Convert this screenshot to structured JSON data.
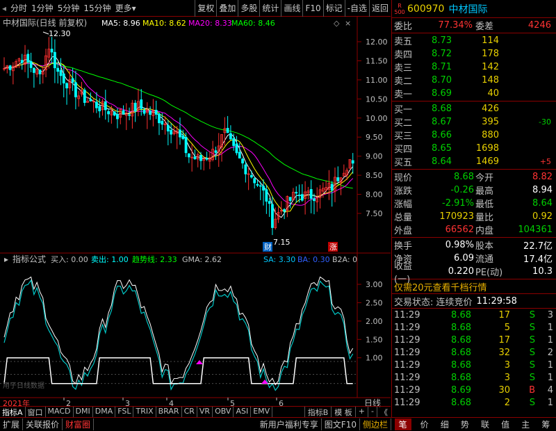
{
  "toolbar": {
    "items": [
      "分时",
      "1分钟",
      "5分钟",
      "15分钟",
      "更多",
      "复权",
      "叠加",
      "多股",
      "统计",
      "画线",
      "F10",
      "标记",
      "-自选",
      "返回"
    ]
  },
  "main_chart": {
    "title": "中材国际(日线 前复权)",
    "ma5_label": "MA5: 8.96",
    "ma10_label": "MA10: 8.62",
    "ma20_label": "MA20: 8.33",
    "ma60_label": "MA60: 8.46",
    "high_marker": "12.30",
    "low_marker": "7.15",
    "badge_cai": "财",
    "badge_zhang": "涨",
    "price_ticks": [
      "12.00",
      "11.50",
      "11.00",
      "10.50",
      "10.00",
      "9.50",
      "9.00",
      "8.50",
      "8.00",
      "7.50"
    ],
    "colors": {
      "ma5": "#ffffff",
      "ma10": "#ffff00",
      "ma20": "#ff00ff",
      "ma60": "#00ff00",
      "up": "#ff3030",
      "down": "#00ffff"
    }
  },
  "indicator": {
    "title": "指标公式",
    "buy_label": "买入: 0.00",
    "sell_label": "卖出: 1.00",
    "trend_label": "趋势线: 2.33",
    "gma_label": "GMA: 2.62",
    "sa_label": "SA: 3.30",
    "ba_label": "BA: 0.30",
    "b2a_label": "B2A: 0",
    "ticks": [
      "3.00",
      "2.50",
      "2.00",
      "1.50",
      "1.00"
    ],
    "watermark": "用于日线数据"
  },
  "timeline": {
    "year": "2021年",
    "months": [
      "2",
      "3",
      "4",
      "5",
      "6"
    ],
    "period": "日线"
  },
  "indicator_tabs": [
    "指标A",
    "窗口",
    "MACD",
    "DMI",
    "DMA",
    "FSL",
    "TRIX",
    "BRAR",
    "CR",
    "VR",
    "OBV",
    "ASI",
    "EMV"
  ],
  "indicator_tab_right": [
    "指标B",
    "模 板",
    "+",
    "-",
    "《"
  ],
  "bottom_left": [
    "扩展",
    "关联报价",
    "财富圈"
  ],
  "bottom_mid": [
    "新用户福利专享",
    "图文F10",
    "侧边栏"
  ],
  "bottom_right": [
    "笔",
    "价",
    "细",
    "势",
    "联",
    "值",
    "主",
    "筹"
  ],
  "stock": {
    "code": "600970",
    "name": "中材国际",
    "badge_top": "R",
    "badge_bottom": "500",
    "weibi_label": "委比",
    "weibi_value": "77.34%",
    "weicha_label": "委差",
    "weicha_value": "4246"
  },
  "sell_orders": [
    {
      "label": "卖五",
      "price": "8.73",
      "vol": "114",
      "chg": ""
    },
    {
      "label": "卖四",
      "price": "8.72",
      "vol": "178",
      "chg": ""
    },
    {
      "label": "卖三",
      "price": "8.71",
      "vol": "142",
      "chg": ""
    },
    {
      "label": "卖二",
      "price": "8.70",
      "vol": "148",
      "chg": ""
    },
    {
      "label": "卖一",
      "price": "8.69",
      "vol": "40",
      "chg": ""
    }
  ],
  "buy_orders": [
    {
      "label": "买一",
      "price": "8.68",
      "vol": "426",
      "chg": ""
    },
    {
      "label": "买二",
      "price": "8.67",
      "vol": "395",
      "chg": "-30"
    },
    {
      "label": "买三",
      "price": "8.66",
      "vol": "880",
      "chg": ""
    },
    {
      "label": "买四",
      "price": "8.65",
      "vol": "1698",
      "chg": ""
    },
    {
      "label": "买五",
      "price": "8.64",
      "vol": "1469",
      "chg": "+5"
    }
  ],
  "quote": [
    {
      "l1": "现价",
      "v1": "8.68",
      "l2": "今开",
      "v2": "8.82"
    },
    {
      "l1": "涨跌",
      "v1": "-0.26",
      "l2": "最高",
      "v2": "8.94"
    },
    {
      "l1": "涨幅",
      "v1": "-2.91%",
      "l2": "最低",
      "v2": "8.64"
    },
    {
      "l1": "总量",
      "v1": "170923",
      "l2": "量比",
      "v2": "0.92"
    },
    {
      "l1": "外盘",
      "v1": "66562",
      "l2": "内盘",
      "v2": "104361"
    }
  ],
  "extra": [
    {
      "l1": "换手",
      "v1": "0.98%",
      "l2": "股本",
      "v2": "22.7亿"
    },
    {
      "l1": "净资",
      "v1": "6.09",
      "l2": "流通",
      "v2": "17.4亿"
    },
    {
      "l1": "收益(一)",
      "v1": "0.220",
      "l2": "PE(动)",
      "v2": "10.3"
    }
  ],
  "promo": "仅需20元查看千档行情",
  "trade_status": {
    "label": "交易状态: 连续竞价",
    "time": "11:29:58"
  },
  "ticks": [
    {
      "time": "11:29",
      "price": "8.68",
      "vol": "17",
      "side": "S",
      "n": "3"
    },
    {
      "time": "11:29",
      "price": "8.68",
      "vol": "5",
      "side": "S",
      "n": "1"
    },
    {
      "time": "11:29",
      "price": "8.68",
      "vol": "17",
      "side": "S",
      "n": "1"
    },
    {
      "time": "11:29",
      "price": "8.68",
      "vol": "32",
      "side": "S",
      "n": "2"
    },
    {
      "time": "11:29",
      "price": "8.68",
      "vol": "3",
      "side": "S",
      "n": "1"
    },
    {
      "time": "11:29",
      "price": "8.68",
      "vol": "3",
      "side": "S",
      "n": "1"
    },
    {
      "time": "11:29",
      "price": "8.69",
      "vol": "30",
      "side": "B",
      "n": "4"
    },
    {
      "time": "11:29",
      "price": "8.68",
      "vol": "2",
      "side": "S",
      "n": "1"
    }
  ]
}
